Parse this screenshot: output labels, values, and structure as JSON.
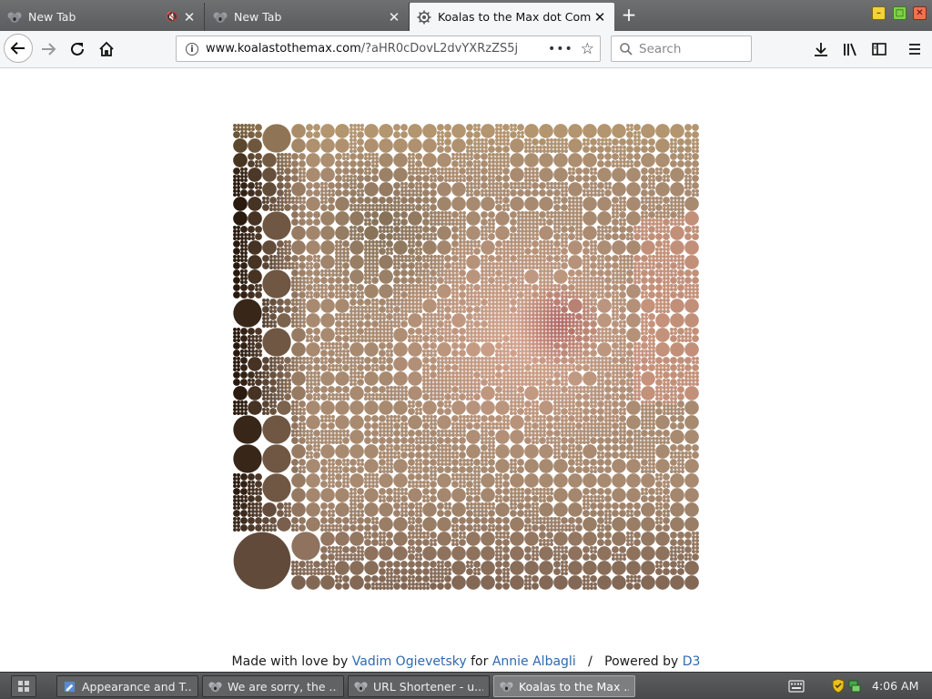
{
  "browser": {
    "tabs": [
      {
        "title": "New Tab",
        "active": false,
        "muted": true,
        "favicon": "koala-icon"
      },
      {
        "title": "New Tab",
        "active": false,
        "muted": false,
        "favicon": "koala-icon"
      },
      {
        "title": "Koalas to the Max dot Com",
        "active": true,
        "muted": false,
        "favicon": "gear-icon"
      }
    ],
    "new_tab_icon": "plus-icon",
    "window_controls": [
      "minimize",
      "maximize",
      "close"
    ],
    "url_prefix": "www.koalastothemax.com",
    "url_rest": "/?aHR0cDovL2dvYXRzZS5j",
    "page_actions_icon": "ellipsis-icon",
    "bookmark_icon": "star-icon",
    "search_placeholder": "Search",
    "toolbar_icons": [
      "download-icon",
      "library-icon",
      "sidebar-icon",
      "menu-icon"
    ]
  },
  "page": {
    "credit_prefix": "Made with love by",
    "author": "Vadim Ogievetsky",
    "credit_for": "for",
    "recipient": "Annie Albagli",
    "separator": "/",
    "powered_prefix": "Powered by",
    "powered_name": "D3",
    "link_color": "#2c6bb0",
    "mosaic_image": "koala-style dot mosaic of a blurred photo in brown and pink tones"
  },
  "taskbar": {
    "start_icon": "app-grid-icon",
    "tasks": [
      {
        "label": "Appearance and T...",
        "icon": "settings-icon",
        "active": false
      },
      {
        "label": "We are sorry, the ...",
        "icon": "koala-icon",
        "active": false
      },
      {
        "label": "URL Shortener - u...",
        "icon": "koala-icon",
        "active": false
      },
      {
        "label": "Koalas to the Max ...",
        "icon": "koala-icon",
        "active": true
      }
    ],
    "tray_icons": [
      "keyboard-icon",
      "shield-icon",
      "network-icon"
    ],
    "clock": "4:06 AM"
  }
}
